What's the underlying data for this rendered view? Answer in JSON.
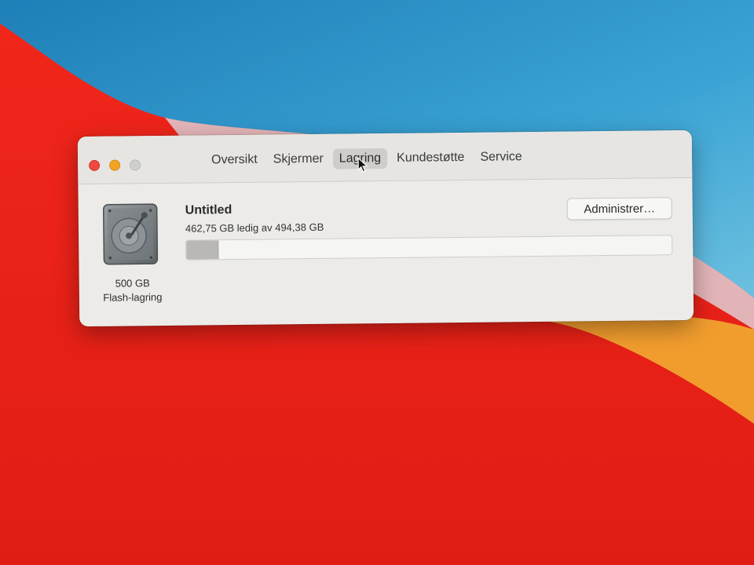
{
  "tabs": [
    {
      "label": "Oversikt",
      "active": false
    },
    {
      "label": "Skjermer",
      "active": false
    },
    {
      "label": "Lagring",
      "active": true
    },
    {
      "label": "Kundestøtte",
      "active": false
    },
    {
      "label": "Service",
      "active": false
    }
  ],
  "disk": {
    "capacity_label": "500 GB",
    "type_label": "Flash-lagring",
    "name": "Untitled",
    "free_text": "462,75 GB ledig av 494,38 GB",
    "used_fraction": 0.064
  },
  "manage_button": {
    "label": "Administrer…"
  },
  "colors": {
    "close": "#ee4a3f",
    "minimize": "#f3a424",
    "zoom": "#cfcfcd",
    "wallpaper_red": "#e8261c",
    "wallpaper_blue": "#2b8fc4",
    "wallpaper_orange": "#f0a030"
  },
  "icons": {
    "window_close": "close-icon",
    "window_minimize": "minimize-icon",
    "window_zoom": "zoom-icon",
    "disk": "hard-drive-icon",
    "pointer": "mouse-pointer-icon"
  }
}
